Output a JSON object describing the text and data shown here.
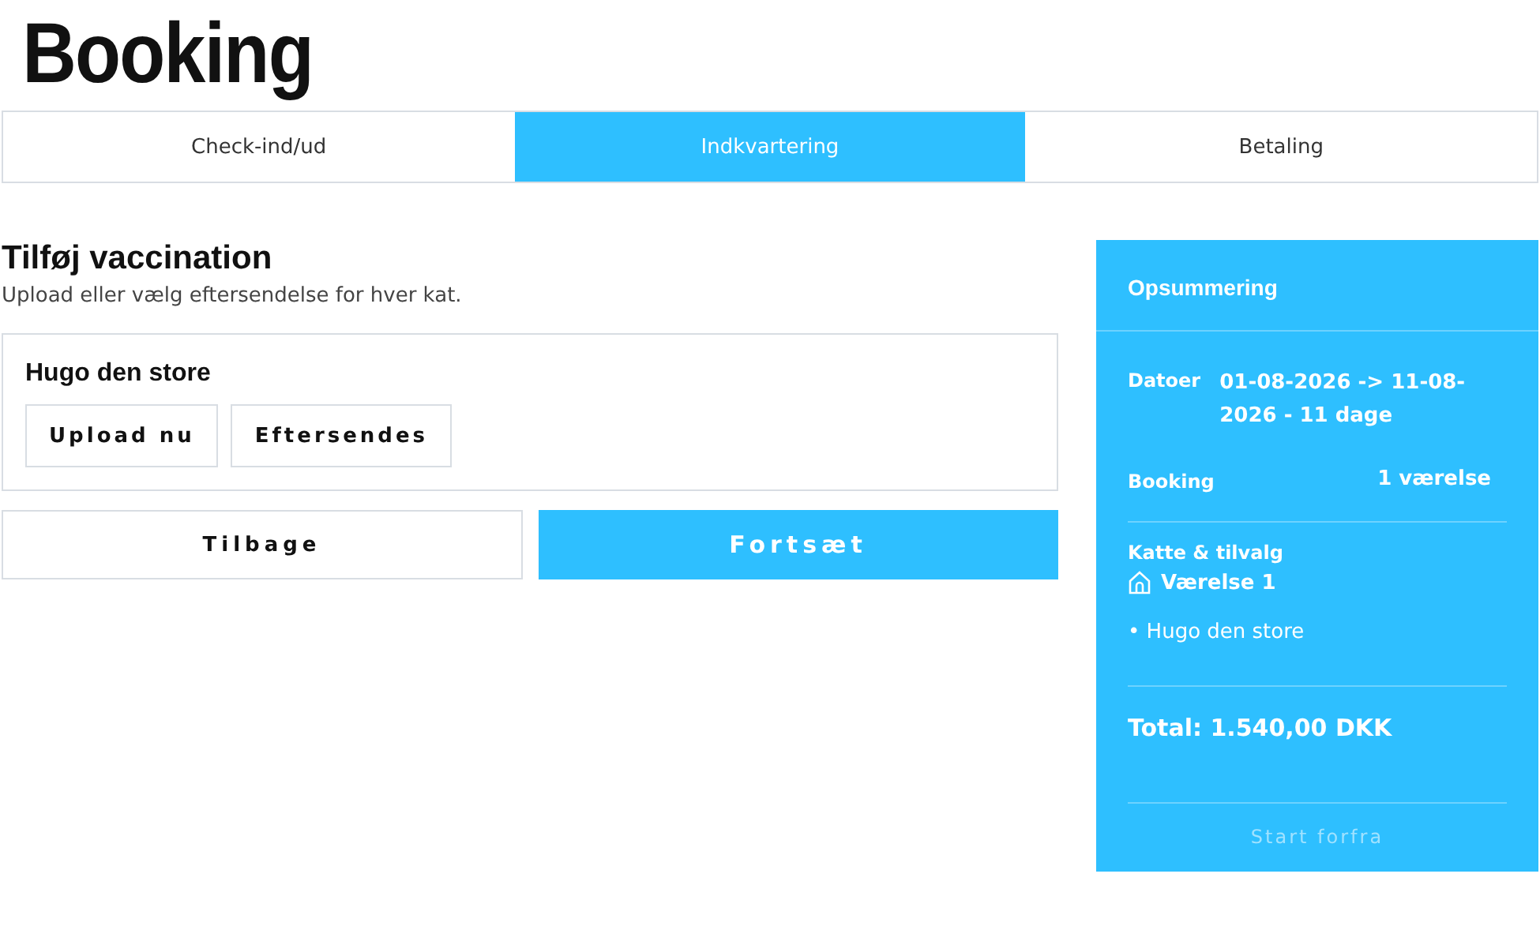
{
  "page_title": "Booking",
  "tabs": [
    {
      "label": "Check-ind/ud",
      "selected": false
    },
    {
      "label": "Indkvartering",
      "selected": true
    },
    {
      "label": "Betaling",
      "selected": false
    }
  ],
  "section": {
    "title": "Tilføj vaccination",
    "description": "Upload eller vælg eftersendelse for hver kat."
  },
  "cats": [
    {
      "name": "Hugo den store",
      "buttons": [
        "Upload nu",
        "Eftersendes"
      ]
    }
  ],
  "nav_buttons": [
    {
      "label": "Tilbage",
      "kind": "secondary"
    },
    {
      "label": "Fortsæt",
      "kind": "primary"
    }
  ],
  "summary": {
    "title": "Opsummering",
    "dates_label": "Datoer",
    "dates_value": "01-08-2026 -> 11-08-2026 - 11 dage",
    "booking_label": "Booking",
    "booking_value": "1 værelse",
    "extras_label": "Katte & tilvalg",
    "room": "Værelse 1",
    "cat_items": [
      "• Hugo den store"
    ],
    "total": "Total: 1.540,00 DKK",
    "reset_button": "Start forfra"
  }
}
